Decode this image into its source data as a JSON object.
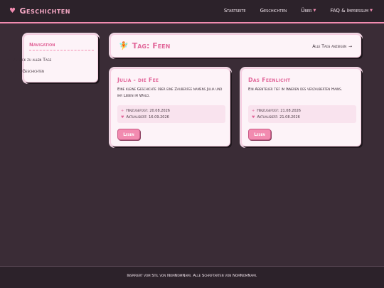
{
  "site": {
    "title": "Geschichten",
    "logo_icon": "heart-icon",
    "accent": "#f28bb0"
  },
  "nav": {
    "items": [
      {
        "label": "Startseite",
        "has_caret": false
      },
      {
        "label": "Geschichten",
        "has_caret": false
      },
      {
        "label": "Über",
        "has_caret": true
      },
      {
        "label": "FAQ & Impressum",
        "has_caret": true
      }
    ]
  },
  "sidebar": {
    "title": "Navigation",
    "links": [
      {
        "icon": "arrow-left-icon",
        "label": "Zurück zu allen Tags"
      },
      {
        "icon": "heart-icon",
        "label": "Alle Geschichten"
      }
    ]
  },
  "header": {
    "icon": "fairy-icon",
    "title": "Tag: Feen",
    "all_tags_label": "Alle Tags anzeigen"
  },
  "stories": [
    {
      "title": "Julia - die Fee",
      "description": "Eine kleine Geschichte über eine Zauberfee namens Julia und ihr Leben im Wald.",
      "added": "Hinzugefügt: 20.08.2026",
      "updated": "Aktualisiert: 16.09.2026",
      "read_label": "Lesen"
    },
    {
      "title": "Das Feenlicht",
      "description": "Ein Abenteuer tief im Inneren des verzauberten Hains.",
      "added": "Hinzugefügt: 21.08.2026",
      "updated": "Aktualisiert: 21.08.2026",
      "read_label": "Lesen"
    }
  ],
  "footer": {
    "text": "Inspiriert vom Stil von NomNomNami. Alle Schriftarten von NomNomNami."
  }
}
